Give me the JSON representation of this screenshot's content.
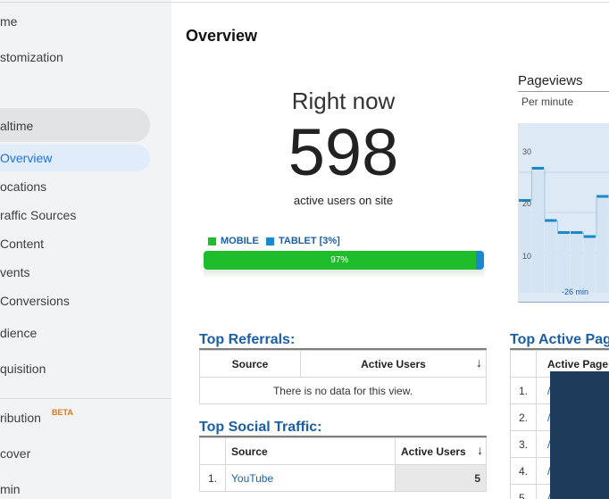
{
  "sidebar": {
    "items": [
      {
        "label": "me"
      },
      {
        "label": "stomization"
      },
      {
        "label": "altime"
      },
      {
        "label": "Overview"
      },
      {
        "label": "ocations"
      },
      {
        "label": "raffic Sources"
      },
      {
        "label": "Content"
      },
      {
        "label": "vents"
      },
      {
        "label": "Conversions"
      },
      {
        "label": "dience"
      },
      {
        "label": "quisition"
      },
      {
        "label": "ribution"
      },
      {
        "label": "cover"
      },
      {
        "label": "min"
      }
    ],
    "beta_badge": "BETA"
  },
  "page_title": "Overview",
  "right_now": {
    "heading": "Right now",
    "count": "598",
    "caption": "active users on site"
  },
  "device_split": {
    "mobile_label": "MOBILE",
    "tablet_label": "TABLET [3%]",
    "mobile_percent_label": "97%",
    "mobile_fraction": 0.97,
    "mobile_color": "#1fbd2b",
    "tablet_color": "#1a88d0"
  },
  "pageviews": {
    "title": "Pageviews",
    "subtitle": "Per minute",
    "y_ticks": [
      "30",
      "20",
      "10"
    ],
    "x_label": "-26 min",
    "chart_data": {
      "type": "bar",
      "ylim": [
        0,
        40
      ],
      "values": [
        23,
        31,
        18,
        15,
        15,
        14,
        24
      ]
    }
  },
  "top_referrals": {
    "title": "Top Referrals:",
    "col_source": "Source",
    "col_active": "Active Users",
    "empty_message": "There is no data for this view."
  },
  "top_social": {
    "title": "Top Social Traffic:",
    "col_source": "Source",
    "col_active": "Active Users",
    "rows": [
      {
        "index": "1.",
        "source": "YouTube",
        "users": "5"
      }
    ]
  },
  "top_active_pages": {
    "title": "Top Active Pag",
    "col_page": "Active Page",
    "rows": [
      {
        "index": "1.",
        "page": "/"
      },
      {
        "index": "2.",
        "page": "/"
      },
      {
        "index": "3.",
        "page": "/"
      },
      {
        "index": "4.",
        "page": "/"
      },
      {
        "index": "5.",
        "page": "/"
      }
    ]
  },
  "colors": {
    "accent_blue": "#1a5fa6",
    "beta_orange": "#e8710a",
    "selected_nav": "#1a73e8"
  }
}
